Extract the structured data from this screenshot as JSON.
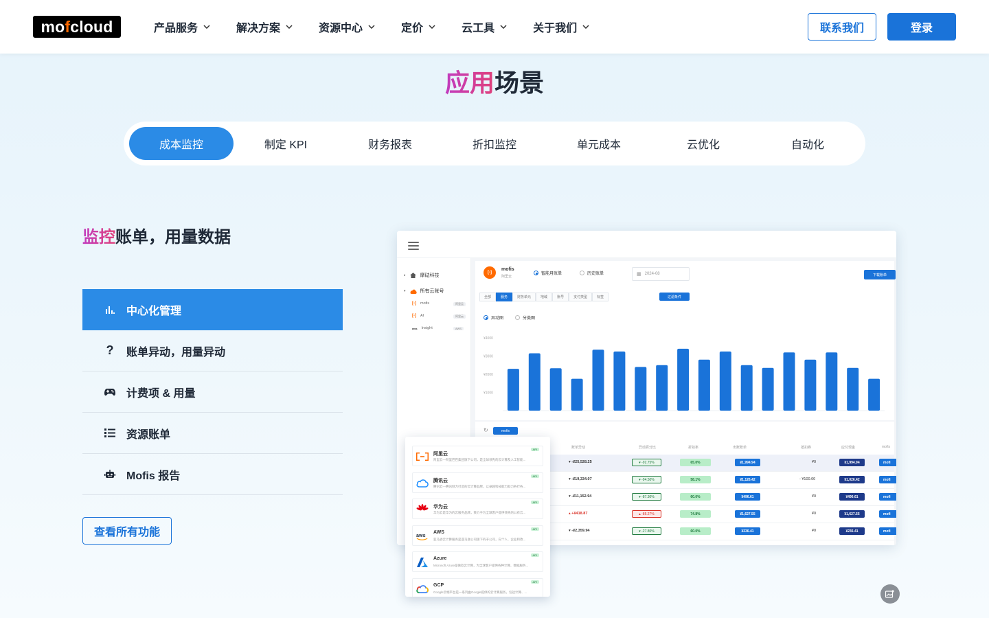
{
  "header": {
    "logo": {
      "part1": "mo",
      "part2": "f",
      "part3": "cloud"
    },
    "nav": [
      "产品服务",
      "解决方案",
      "资源中心",
      "定价",
      "云工具",
      "关于我们"
    ],
    "contact_label": "联系我们",
    "login_label": "登录"
  },
  "section": {
    "title_highlight": "应用",
    "title_rest": "场景"
  },
  "tabs": [
    "成本监控",
    "制定 KPI",
    "财务报表",
    "折扣监控",
    "单元成本",
    "云优化",
    "自动化"
  ],
  "active_tab": "成本监控",
  "feature": {
    "heading_highlight": "监控",
    "heading_rest": "账单，用量数据",
    "items": [
      {
        "label": "中心化管理",
        "icon": "bar-chart-icon"
      },
      {
        "label": "账单异动，用量异动",
        "icon": "question-icon"
      },
      {
        "label": "计费项 & 用量",
        "icon": "gamepad-icon"
      },
      {
        "label": "资源账单",
        "icon": "list-icon"
      },
      {
        "label": "Mofis 报告",
        "icon": "robot-icon"
      }
    ],
    "view_all_label": "查看所有功能"
  },
  "mock": {
    "sidebar": {
      "org": "摩砝科技",
      "all_accounts": "所有云账号",
      "accounts": [
        {
          "name": "mofis",
          "tag": "阿里云"
        },
        {
          "name": "AI",
          "tag": "阿里云"
        },
        {
          "name": "Insight",
          "tag": "AWS"
        }
      ]
    },
    "account_name": "mofis",
    "account_sub": "阿里云",
    "radio_smart": "智能月账单",
    "radio_history": "历史账单",
    "date_value": "2024-08",
    "download_label": "下载账单",
    "subtabs": [
      "全部",
      "服务",
      "财务单元",
      "地域",
      "账号",
      "支付类型",
      "标签"
    ],
    "filter_label": "过滤条件",
    "chart_mode_a": "异动图",
    "chart_mode_b": "分类图",
    "filter_tag": "mofis",
    "table_headers": [
      "账单异动",
      "异动百分比",
      "折扣率",
      "出账账单",
      "抵扣券",
      "应付现金",
      "mofis"
    ],
    "rows": [
      {
        "diff": "▾ -¥25,528.25",
        "pct": "▾ -92.75%",
        "rate": "65.0%",
        "bill": "¥1,994.94",
        "coupon": "¥0",
        "cash": "¥1,994.94",
        "dir": "down"
      },
      {
        "diff": "▾ -¥19,334.07",
        "pct": "▾ -94.50%",
        "rate": "58.1%",
        "bill": "¥1,126.42",
        "coupon": "- ¥100.00",
        "cash": "¥1,026.42",
        "dir": "down"
      },
      {
        "diff": "▾ -¥11,152.94",
        "pct": "▾ -87.30%",
        "rate": "60.0%",
        "bill": "¥496.61",
        "coupon": "¥0",
        "cash": "¥496.61",
        "dir": "down"
      },
      {
        "diff": "▴ +¥418.87",
        "pct": "▴ -85.27%",
        "rate": "74.8%",
        "bill": "¥1,627.55",
        "coupon": "¥0",
        "cash": "¥1,627.55",
        "dir": "up"
      },
      {
        "diff": "▾ -¥2,359.94",
        "pct": "▾ -27.80%",
        "rate": "60.0%",
        "bill": "¥236.41",
        "coupon": "¥0",
        "cash": "¥236.41",
        "dir": "down"
      }
    ],
    "row_tail": "mofi"
  },
  "chart_data": {
    "type": "bar",
    "ylabels": [
      "¥4000",
      "¥3000",
      "¥2000",
      "¥1000"
    ],
    "ylim": [
      0,
      4000
    ],
    "values": [
      2300,
      3150,
      2330,
      1750,
      3350,
      3250,
      2400,
      2500,
      3400,
      2800,
      3250,
      2500,
      2350,
      3200,
      2800,
      3200,
      2350,
      1750
    ],
    "colors": {
      "bar": "#1a73d9"
    }
  },
  "providers": [
    {
      "name": "阿里云",
      "desc": "阿里云—阿里巴巴集团旗下公司，是全球领先的云计算及人工智能...",
      "tag": "API",
      "icon": "aliyun-icon"
    },
    {
      "name": "腾讯云",
      "desc": "腾讯云—腾讯倾力打造的云计算品牌，以卓越科技能力助力各行各...",
      "tag": "API",
      "icon": "tencent-cloud-icon"
    },
    {
      "name": "华为云",
      "desc": "华为云是华为的云服务品牌，致力于为全球客户提供领先的公有云...",
      "tag": "API",
      "icon": "huawei-icon"
    },
    {
      "name": "AWS",
      "desc": "亚马逊云计算服务是亚马逊公司旗下的子公司，向个人、企业和政...",
      "tag": "API",
      "icon": "aws-icon"
    },
    {
      "name": "Azure",
      "desc": "Microsoft Azure是微软云计算，为全球客户提供各种计算、数据服务...",
      "tag": "API",
      "icon": "azure-icon"
    },
    {
      "name": "GCP",
      "desc": "Google云端平台是一系列由Google提供的云计算服务，包括计算、...",
      "tag": "API",
      "icon": "gcp-icon"
    }
  ],
  "colors": {
    "primary": "#1a73d9",
    "accent": "#2b8be6",
    "gradient_start": "#c13bbf",
    "gradient_end": "#e0407a"
  }
}
